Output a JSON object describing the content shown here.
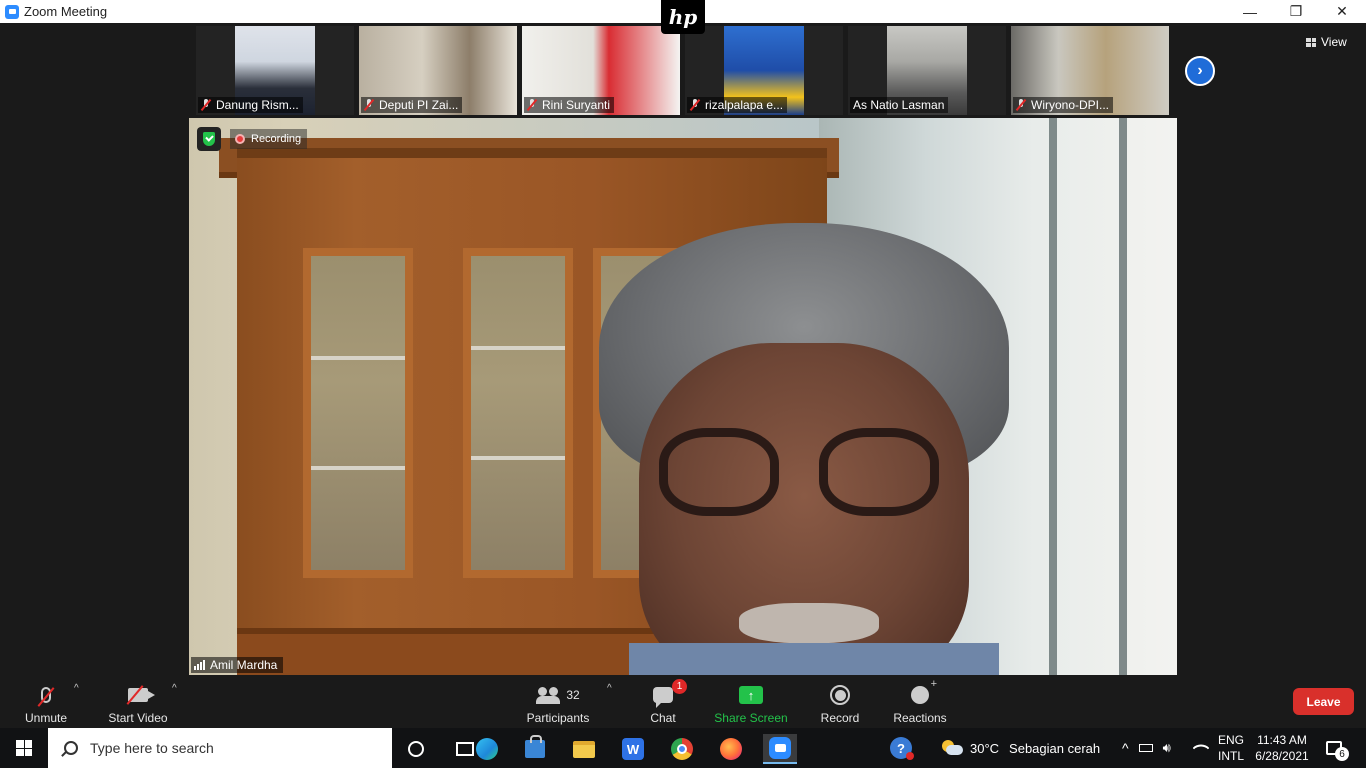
{
  "window": {
    "title": "Zoom Meeting",
    "controls": [
      "—",
      "❐",
      "✕"
    ]
  },
  "hp_logo": "hp",
  "gallery": {
    "participants": [
      {
        "name": "Danung Rism...",
        "muted": true
      },
      {
        "name": "Deputi PI Zai...",
        "muted": true
      },
      {
        "name": "Rini Suryanti",
        "muted": true
      },
      {
        "name": "rizalpalapa e...",
        "muted": true
      },
      {
        "name": "As Natio Lasman",
        "muted": false
      },
      {
        "name": "Wiryono-DPI...",
        "muted": true
      }
    ],
    "next_icon": "›",
    "view_label": "View"
  },
  "main_video": {
    "recording_label": "Recording",
    "speaker_name": "Amil Mardha"
  },
  "toolbar": {
    "unmute_label": "Unmute",
    "start_video_label": "Start Video",
    "participants_label": "Participants",
    "participants_count": "32",
    "chat_label": "Chat",
    "chat_badge": "1",
    "share_label": "Share Screen",
    "share_arrow": "↑",
    "record_label": "Record",
    "reactions_label": "Reactions",
    "leave_label": "Leave",
    "caret": "^",
    "colors": {
      "share": "#23c24a",
      "leave": "#d9302b",
      "accent": "#2d8cff"
    }
  },
  "taskbar": {
    "search_placeholder": "Type here to search",
    "apps": [
      "cortana-icon",
      "task-view-icon",
      "edge-icon",
      "store-icon",
      "file-explorer-icon",
      "wps-icon",
      "chrome-icon",
      "firefox-icon",
      "zoom-icon"
    ],
    "wps_glyph": "W",
    "help_glyph": "?",
    "weather_temp": "30°C",
    "weather_text": "Sebagian cerah",
    "tray_chevron": "^",
    "lang_top": "ENG",
    "lang_bottom": "INTL",
    "time": "11:43 AM",
    "date": "6/28/2021",
    "notification_count": "6"
  }
}
